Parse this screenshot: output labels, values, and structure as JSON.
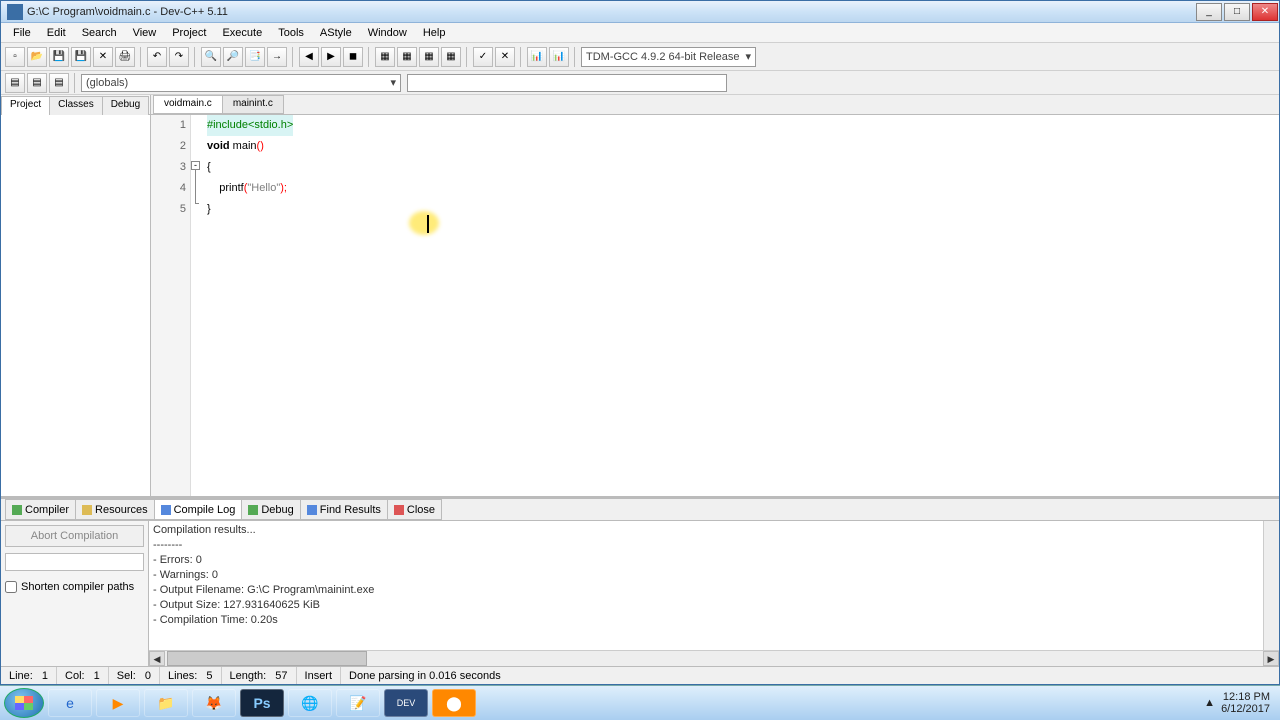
{
  "window": {
    "title": "G:\\C Program\\voidmain.c - Dev-C++ 5.11"
  },
  "menu": [
    "File",
    "Edit",
    "Search",
    "View",
    "Project",
    "Execute",
    "Tools",
    "AStyle",
    "Window",
    "Help"
  ],
  "compiler_select": "TDM-GCC 4.9.2 64-bit Release",
  "scope_select": "(globals)",
  "left_tabs": [
    "Project",
    "Classes",
    "Debug"
  ],
  "editor_tabs": [
    "voidmain.c",
    "mainint.c"
  ],
  "code": {
    "line_numbers": [
      "1",
      "2",
      "3",
      "4",
      "5"
    ],
    "l1_include": "#include",
    "l1_rest": "<stdio.h>",
    "l2_void": "void",
    "l2_main": " main",
    "l2_paren": "()",
    "l3": "{",
    "l4_printf": "    printf",
    "l4_paren1": "(",
    "l4_str": "\"Hello\"",
    "l4_paren2": ");",
    "l5": "}"
  },
  "bottom_tabs": [
    "Compiler",
    "Resources",
    "Compile Log",
    "Debug",
    "Find Results",
    "Close"
  ],
  "abort_label": "Abort Compilation",
  "shorten_label": "Shorten compiler paths",
  "log": {
    "l1": "Compilation results...",
    "l2": "--------",
    "l3": "- Errors: 0",
    "l4": "- Warnings: 0",
    "l5": "- Output Filename: G:\\C Program\\mainint.exe",
    "l6": "- Output Size: 127.931640625 KiB",
    "l7": "- Compilation Time: 0.20s"
  },
  "status": {
    "line_lbl": "Line:",
    "line_val": "1",
    "col_lbl": "Col:",
    "col_val": "1",
    "sel_lbl": "Sel:",
    "sel_val": "0",
    "lines_lbl": "Lines:",
    "lines_val": "5",
    "length_lbl": "Length:",
    "length_val": "57",
    "mode": "Insert",
    "parse": "Done parsing in 0.016 seconds"
  },
  "taskbar": {
    "time": "12:18 PM",
    "date": "6/12/2017"
  }
}
